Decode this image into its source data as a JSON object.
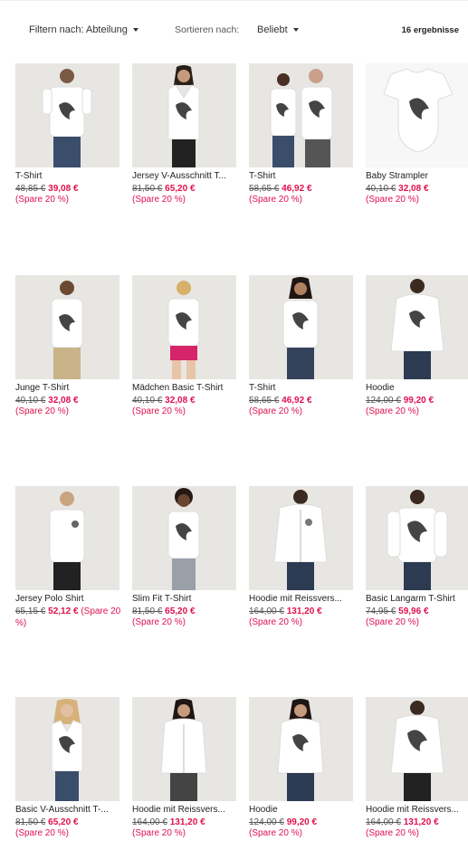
{
  "toolbar": {
    "filter_label": "Filtern nach: Abteilung",
    "sort_label": "Sortieren nach:",
    "sort_value": "Beliebt",
    "results": "16 ergebnisse"
  },
  "products": [
    {
      "title": "T-Shirt",
      "old": "48,85 €",
      "new": "39,08 €",
      "save": "(Spare 20 %)"
    },
    {
      "title": "Jersey V-Ausschnitt T...",
      "old": "81,50 €",
      "new": "65,20 €",
      "save": "(Spare 20 %)"
    },
    {
      "title": "T-Shirt",
      "old": "58,65 €",
      "new": "46,92 €",
      "save": "(Spare 20 %)"
    },
    {
      "title": "Baby Strampler",
      "old": "40,10 €",
      "new": "32,08 €",
      "save": "(Spare 20 %)"
    },
    {
      "title": "Junge T-Shirt",
      "old": "40,10 €",
      "new": "32,08 €",
      "save": "(Spare 20 %)"
    },
    {
      "title": "Mädchen Basic T-Shirt",
      "old": "40,10 €",
      "new": "32,08 €",
      "save": "(Spare 20 %)"
    },
    {
      "title": "T-Shirt",
      "old": "58,65 €",
      "new": "46,92 €",
      "save": "(Spare 20 %)"
    },
    {
      "title": "Hoodie",
      "old": "124,00 €",
      "new": "99,20 €",
      "save": "(Spare 20 %)"
    },
    {
      "title": "Jersey Polo Shirt",
      "old": "65,15 €",
      "new": "52,12 €",
      "save": "(Spare 20 %)"
    },
    {
      "title": "Slim Fit T-Shirt",
      "old": "81,50 €",
      "new": "65,20 €",
      "save": "(Spare 20 %)"
    },
    {
      "title": "Hoodie mit Reissvers...",
      "old": "164,00 €",
      "new": "131,20 €",
      "save": "(Spare 20 %)"
    },
    {
      "title": "Basic Langarm T-Shirt",
      "old": "74,95 €",
      "new": "59,96 €",
      "save": "(Spare 20 %)"
    },
    {
      "title": "Basic V-Ausschnitt T-...",
      "old": "81,50 €",
      "new": "65,20 €",
      "save": "(Spare 20 %)"
    },
    {
      "title": "Hoodie mit Reissvers...",
      "old": "164,00 €",
      "new": "131,20 €",
      "save": "(Spare 20 %)"
    },
    {
      "title": "Hoodie",
      "old": "124,00 €",
      "new": "99,20 €",
      "save": "(Spare 20 %)"
    },
    {
      "title": "Hoodie mit Reissvers...",
      "old": "164,00 €",
      "new": "131,20 €",
      "save": "(Spare 20 %)"
    }
  ],
  "colors": {
    "accent": "#e0104f",
    "thumb_bg": "#e8e6e3"
  }
}
